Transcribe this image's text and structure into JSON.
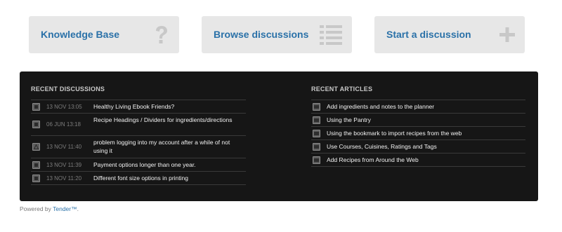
{
  "tiles": [
    {
      "label": "Knowledge Base",
      "icon": "question-mark-icon"
    },
    {
      "label": "Browse discussions",
      "icon": "list-icon"
    },
    {
      "label": "Start a discussion",
      "icon": "plus-icon"
    }
  ],
  "recent_discussions": {
    "title": "RECENT DISCUSSIONS",
    "items": [
      {
        "timestamp": "13 NOV 13:05",
        "title": "Healthy Living Ebook Friends?",
        "icon": "discussion-icon"
      },
      {
        "timestamp": "06 JUN 13:18",
        "title": "Recipe Headings / Dividers for ingredients/directions",
        "icon": "discussion-icon"
      },
      {
        "timestamp": "13 NOV 11:40",
        "title": "problem logging into my account after a while of not using it",
        "icon": "warning-icon"
      },
      {
        "timestamp": "13 NOV 11:39",
        "title": "Payment options longer than one year.",
        "icon": "discussion-icon"
      },
      {
        "timestamp": "13 NOV 11:20",
        "title": "Different font size options in printing",
        "icon": "discussion-icon"
      }
    ]
  },
  "recent_articles": {
    "title": "RECENT ARTICLES",
    "items": [
      {
        "title": "Add ingredients and notes to the planner",
        "icon": "article-icon"
      },
      {
        "title": "Using the Pantry",
        "icon": "article-icon"
      },
      {
        "title": "Using the bookmark to import recipes from the web",
        "icon": "article-icon"
      },
      {
        "title": "Use Courses, Cuisines, Ratings and Tags",
        "icon": "article-icon"
      },
      {
        "title": "Add Recipes from Around the Web",
        "icon": "article-icon"
      }
    ]
  },
  "footer": {
    "prefix": "Powered by ",
    "link": "Tender™",
    "suffix": "."
  },
  "colors": {
    "link": "#2a71a8",
    "tile_bg": "#e7e7e7",
    "panel_bg": "#161616",
    "icon_gray": "#c8c8c8"
  }
}
